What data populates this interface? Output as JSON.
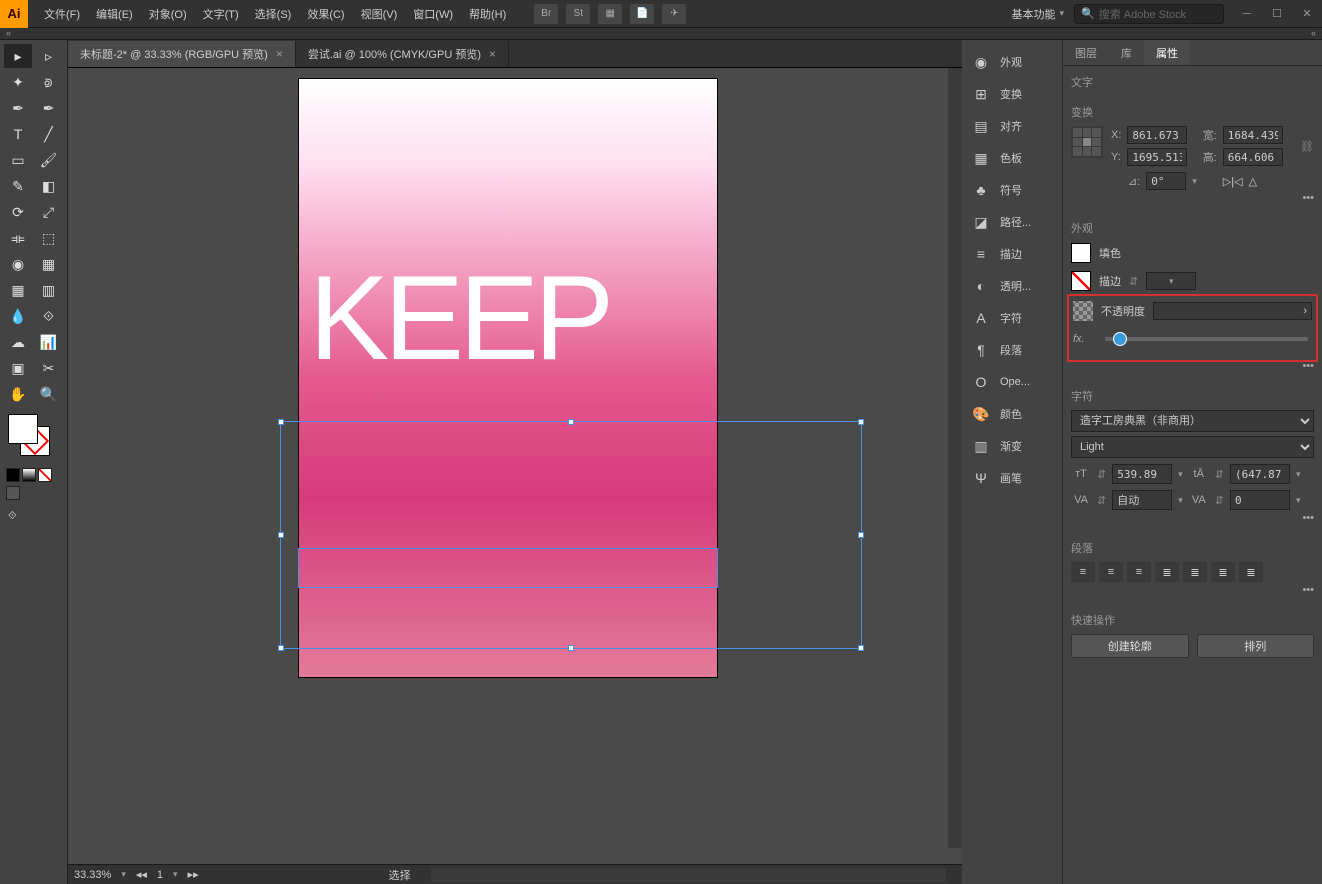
{
  "app": {
    "logo": "Ai"
  },
  "menu": [
    "文件(F)",
    "编辑(E)",
    "对象(O)",
    "文字(T)",
    "选择(S)",
    "效果(C)",
    "视图(V)",
    "窗口(W)",
    "帮助(H)"
  ],
  "tb_icons": [
    "Br",
    "St",
    "▦",
    "📄",
    "✈"
  ],
  "workspace": "基本功能",
  "search_placeholder": "搜索 Adobe Stock",
  "tabs": [
    {
      "label": "未标题-2* @ 33.33% (RGB/GPU 预览)",
      "active": true
    },
    {
      "label": "尝试.ai @ 100% (CMYK/GPU 预览)",
      "active": false
    }
  ],
  "canvas_text": "KEEP",
  "status": {
    "zoom": "33.33%",
    "page": "1",
    "mode": "选择"
  },
  "side_panels": [
    "外观",
    "变换",
    "对齐",
    "色板",
    "符号",
    "路径...",
    "描边",
    "透明...",
    "字符",
    "段落",
    "Ope...",
    "颜色",
    "渐变",
    "画笔"
  ],
  "props": {
    "tabs": [
      "图层",
      "库",
      "属性"
    ],
    "active_tab": "属性",
    "text_section": "文字",
    "transform": {
      "title": "变换",
      "x_label": "X:",
      "x": "861.673",
      "y_label": "Y:",
      "y": "1695.513",
      "w_label": "宽:",
      "w": "1684.439",
      "h_label": "高:",
      "h": "664.606",
      "angle_label": "⊿:",
      "angle": "0°"
    },
    "appearance": {
      "title": "外观",
      "fill": "填色",
      "stroke": "描边",
      "opacity": "不透明度",
      "fx": "fx."
    },
    "character": {
      "title": "字符",
      "font": "造字工房典黑（非商用）",
      "style": "Light",
      "size": "539.89",
      "leading": "(647.87",
      "tracking": "自动",
      "kerning": "0"
    },
    "paragraph": {
      "title": "段落"
    },
    "quick": {
      "title": "快速操作",
      "create_outline": "创建轮廓",
      "arrange": "排列"
    }
  }
}
